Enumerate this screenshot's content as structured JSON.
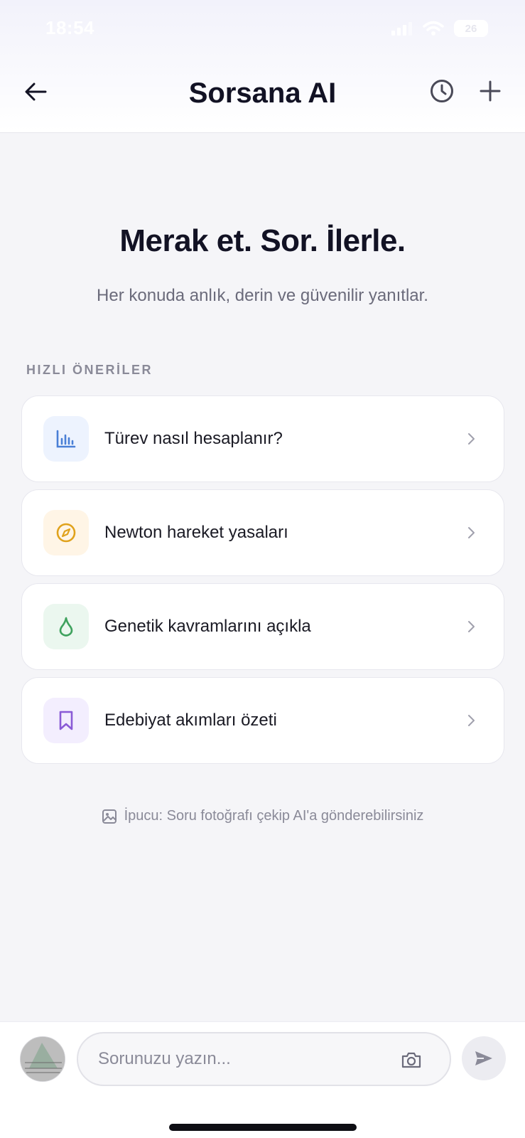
{
  "status_bar": {
    "time": "18:54",
    "battery": "26"
  },
  "header": {
    "title": "Sorsana AI"
  },
  "hero": {
    "title": "Merak et. Sor. İlerle.",
    "subtitle": "Her konuda anlık, derin ve güvenilir yanıtlar."
  },
  "suggestions": {
    "section_label": "HIZLI ÖNERİLER",
    "items": [
      {
        "label": "Türev nasıl hesaplanır?",
        "icon": "bar-chart-icon",
        "color": "#4a7fd6",
        "bg": "#edf3fe"
      },
      {
        "label": "Newton hareket yasaları",
        "icon": "compass-icon",
        "color": "#e0a21c",
        "bg": "#fff5e6"
      },
      {
        "label": "Genetik kavramlarını açıkla",
        "icon": "drop-icon",
        "color": "#3fa25e",
        "bg": "#ebf7ef"
      },
      {
        "label": "Edebiyat akımları özeti",
        "icon": "bookmark-icon",
        "color": "#8a5bd6",
        "bg": "#f3eefe"
      }
    ]
  },
  "tip": {
    "text": "İpucu: Soru fotoğrafı çekip AI'a gönderebilirsiniz"
  },
  "composer": {
    "placeholder": "Sorunuzu yazın..."
  }
}
